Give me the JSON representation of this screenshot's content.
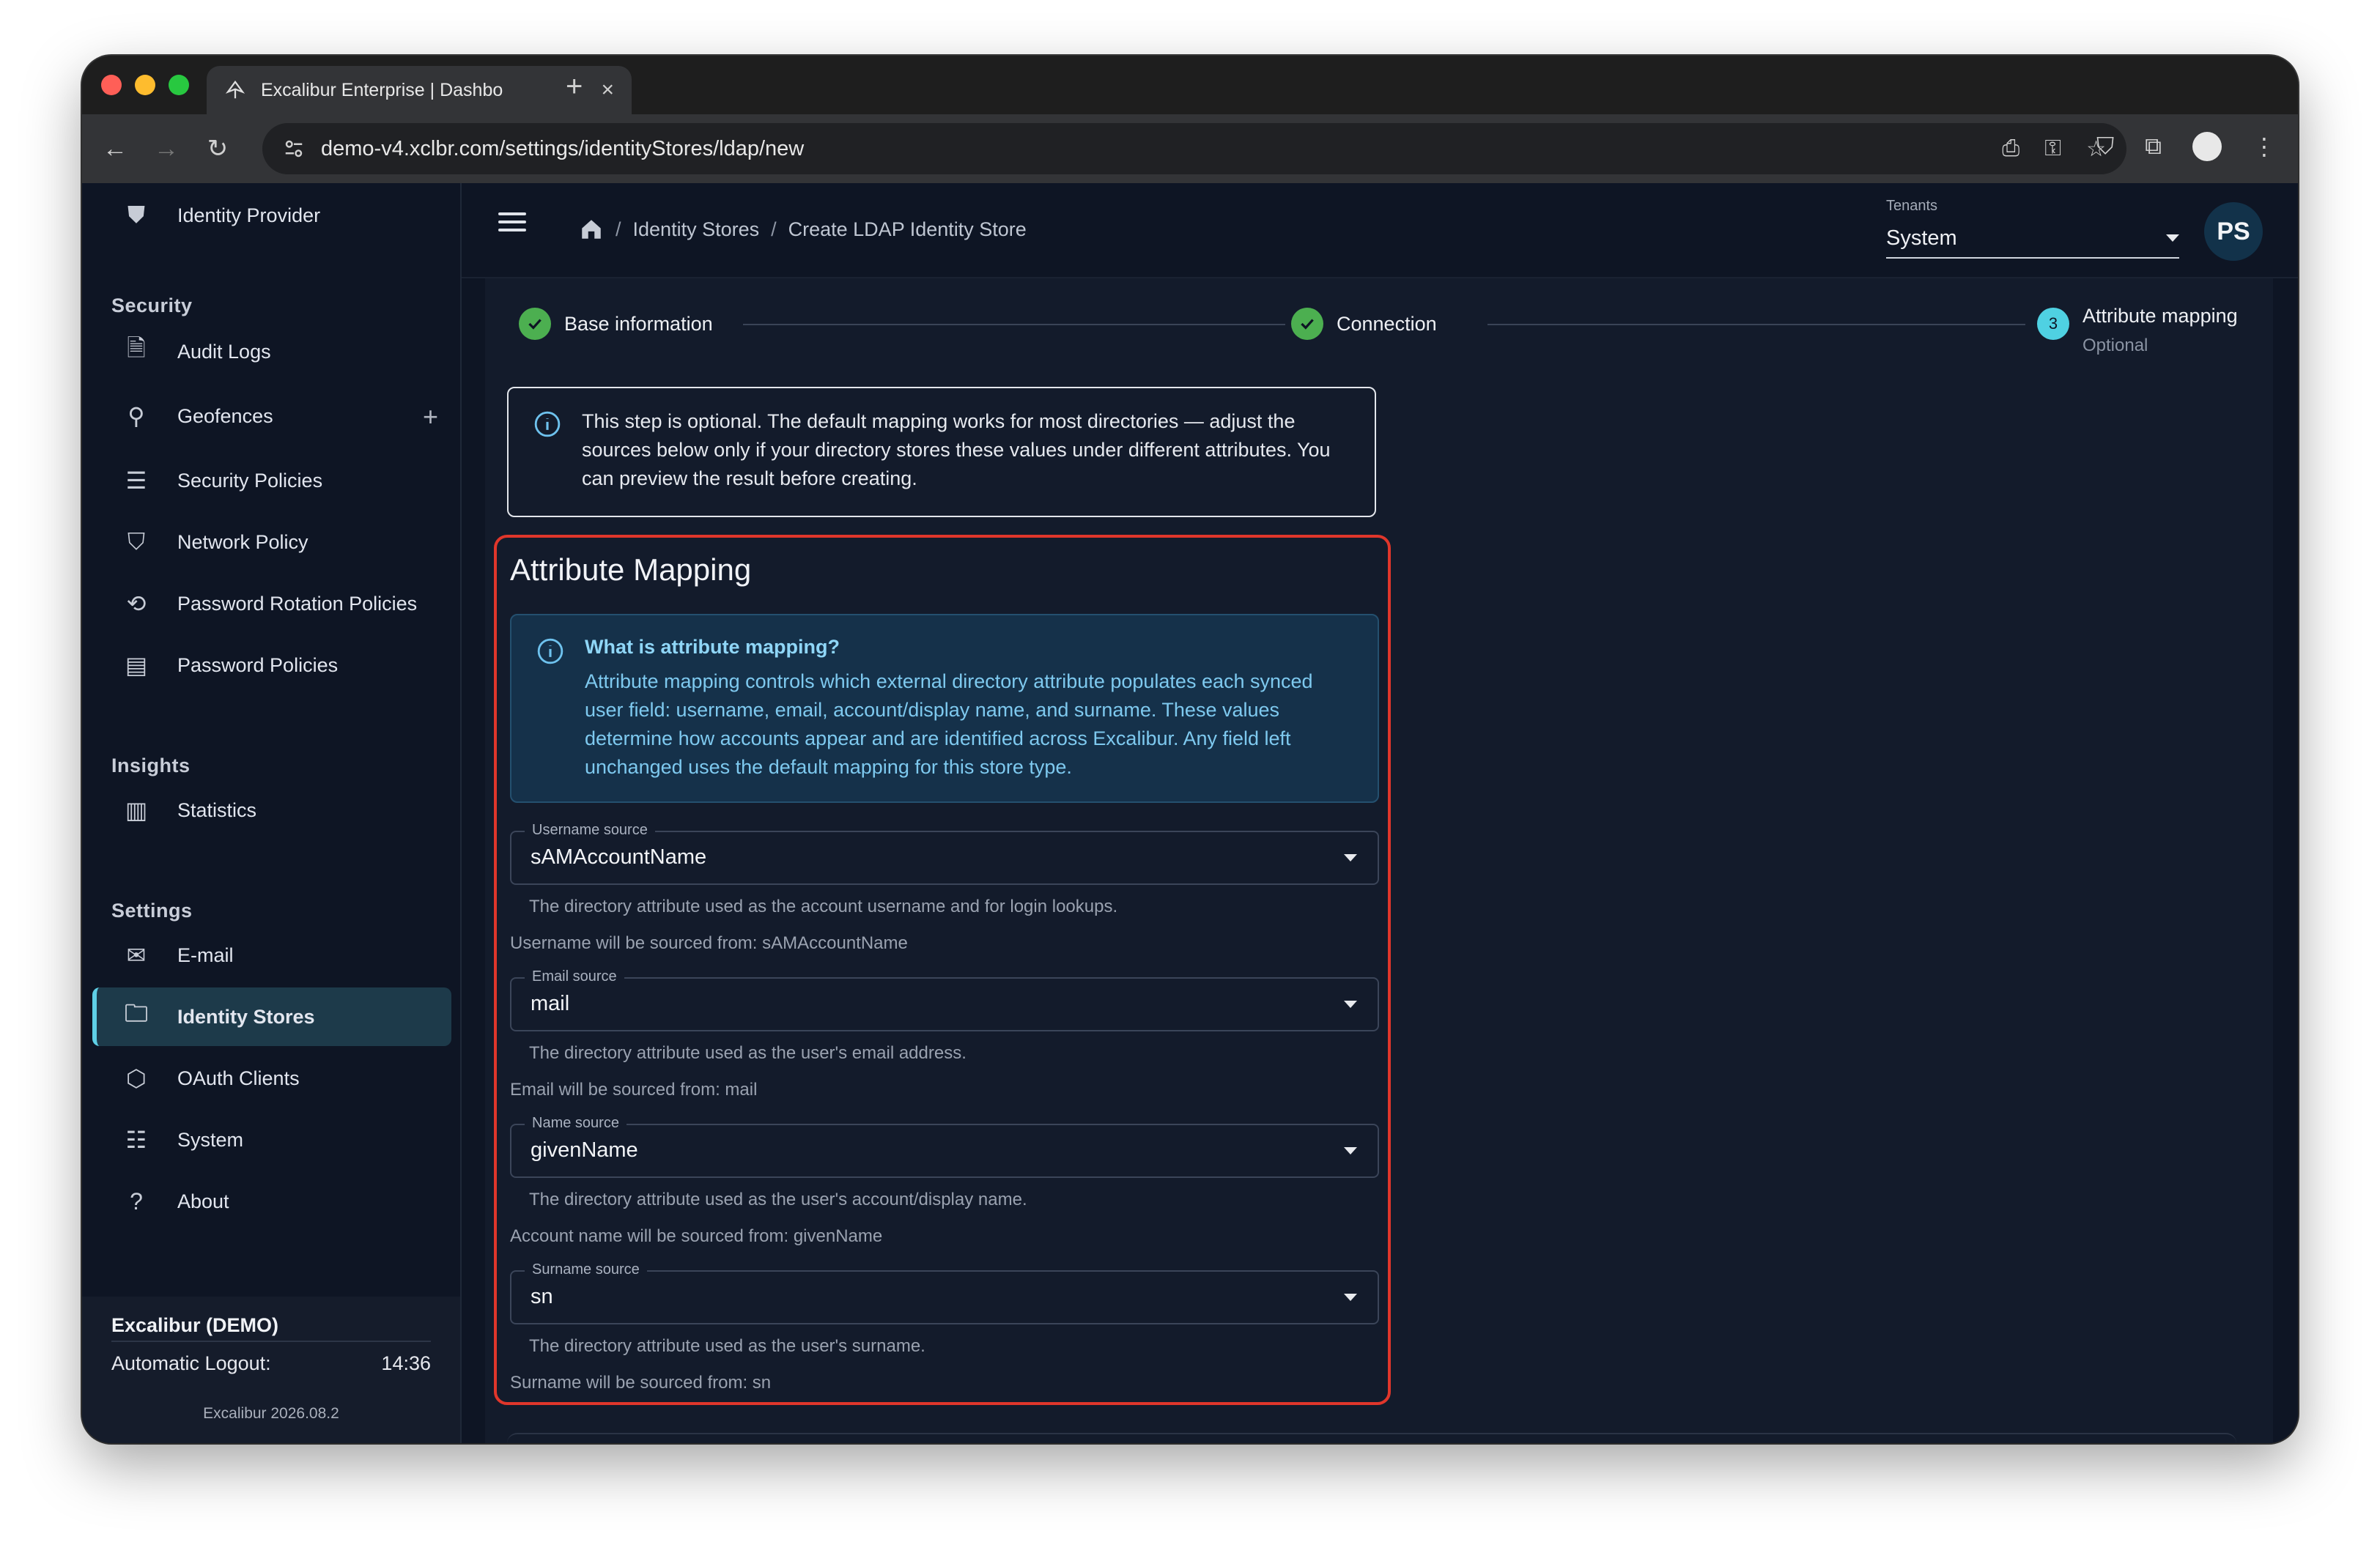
{
  "browser": {
    "tab_title": "Excalibur Enterprise | Dashbo",
    "url": "demo-v4.xclbr.com/settings/identityStores/ldap/new"
  },
  "sidebar": {
    "top_item": "Identity Provider",
    "sections": {
      "security": "Security",
      "insights": "Insights",
      "settings": "Settings"
    },
    "items": {
      "audit_logs": "Audit Logs",
      "geofences": "Geofences",
      "security_policies": "Security Policies",
      "network_policy": "Network Policy",
      "password_rotation": "Password Rotation Policies",
      "password_policies": "Password Policies",
      "statistics": "Statistics",
      "email": "E-mail",
      "identity_stores": "Identity Stores",
      "oauth_clients": "OAuth Clients",
      "system": "System",
      "about": "About"
    },
    "footer": {
      "title": "Excalibur (DEMO)",
      "logout_label": "Automatic Logout:",
      "logout_time": "14:36",
      "version": "Excalibur 2026.08.2"
    }
  },
  "header": {
    "breadcrumbs": [
      "Identity Stores",
      "Create LDAP Identity Store"
    ],
    "tenant_label": "Tenants",
    "tenant_value": "System",
    "avatar_initials": "PS"
  },
  "stepper": {
    "step1": "Base information",
    "step2": "Connection",
    "step3_num": "3",
    "step3": "Attribute mapping",
    "step3_sub": "Optional"
  },
  "info_alert": "This step is optional. The default mapping works for most directories — adjust the sources below only if your directory stores these values under different attributes. You can preview the result before creating.",
  "mapping": {
    "title": "Attribute Mapping",
    "help_title": "What is attribute mapping?",
    "help_text": "Attribute mapping controls which external directory attribute populates each synced user field: username, email, account/display name, and surname. These values determine how accounts appear and are identified across Excalibur. Any field left unchanged uses the default mapping for this store type.",
    "fields": [
      {
        "label": "Username source",
        "value": "sAMAccountName",
        "helper": "The directory attribute used as the account username and for login lookups.",
        "sourced": "Username will be sourced from: sAMAccountName"
      },
      {
        "label": "Email source",
        "value": "mail",
        "helper": "The directory attribute used as the user's email address.",
        "sourced": "Email will be sourced from: mail"
      },
      {
        "label": "Name source",
        "value": "givenName",
        "helper": "The directory attribute used as the user's account/display name.",
        "sourced": "Account name will be sourced from: givenName"
      },
      {
        "label": "Surname source",
        "value": "sn",
        "helper": "The directory attribute used as the user's surname.",
        "sourced": "Surname will be sourced from: sn"
      }
    ]
  },
  "colors": {
    "accent": "#5fd0e6",
    "success": "#4caf50",
    "highlight": "#e0362b"
  }
}
